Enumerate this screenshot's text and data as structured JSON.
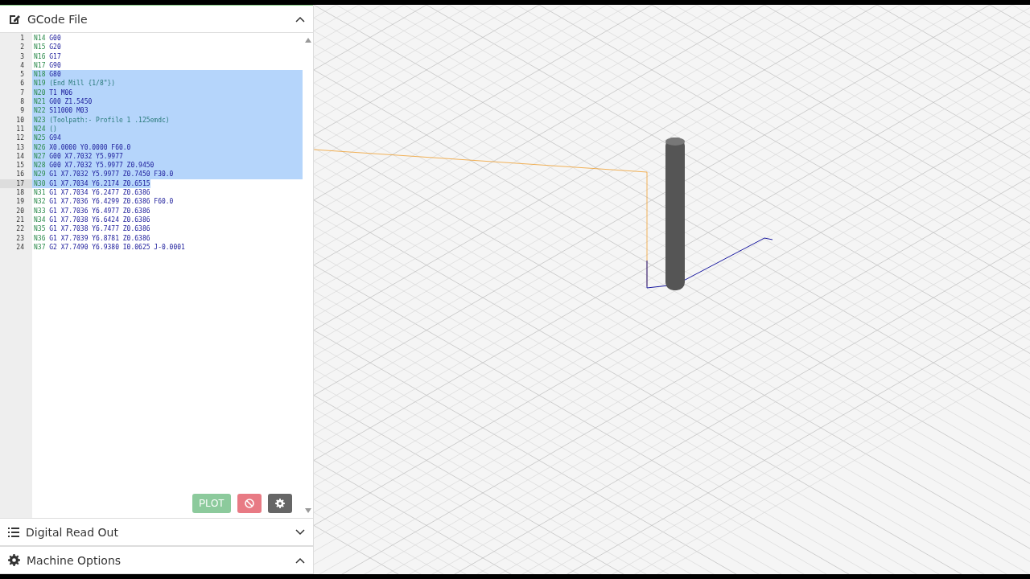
{
  "panels": [
    {
      "title": "GCode File",
      "kind": "edit",
      "expanded": true
    },
    {
      "title": "Digital Read Out",
      "kind": "list",
      "expanded": false
    },
    {
      "title": "Machine Options",
      "kind": "gear",
      "expanded": true
    }
  ],
  "editor": {
    "lines": [
      {
        "num": "1",
        "n": "N14",
        "code": "G00",
        "kind": "code",
        "selected": false,
        "current": false
      },
      {
        "num": "2",
        "n": "N15",
        "code": "G20",
        "kind": "code",
        "selected": false,
        "current": false
      },
      {
        "num": "3",
        "n": "N16",
        "code": "G17",
        "kind": "code",
        "selected": false,
        "current": false
      },
      {
        "num": "4",
        "n": "N17",
        "code": "G90",
        "kind": "code",
        "selected": false,
        "current": false
      },
      {
        "num": "5",
        "n": "N18",
        "code": "G80",
        "kind": "code",
        "selected": true,
        "current": false
      },
      {
        "num": "6",
        "n": "N19",
        "code": "(End Mill {1/8\"})",
        "kind": "comment",
        "selected": true,
        "current": false
      },
      {
        "num": "7",
        "n": "N20",
        "code": "T1 M06",
        "kind": "code",
        "selected": true,
        "current": false
      },
      {
        "num": "8",
        "n": "N21",
        "code": "G00 Z1.5450",
        "kind": "code",
        "selected": true,
        "current": false
      },
      {
        "num": "9",
        "n": "N22",
        "code": "S11000 M03",
        "kind": "code",
        "selected": true,
        "current": false
      },
      {
        "num": "10",
        "n": "N23",
        "code": "(Toolpath:- Profile 1 .125emdc)",
        "kind": "comment",
        "selected": true,
        "current": false
      },
      {
        "num": "11",
        "n": "N24",
        "code": "()",
        "kind": "comment",
        "selected": true,
        "current": false
      },
      {
        "num": "12",
        "n": "N25",
        "code": "G94",
        "kind": "code",
        "selected": true,
        "current": false
      },
      {
        "num": "13",
        "n": "N26",
        "code": "X0.0000 Y0.0000 F60.0",
        "kind": "code",
        "selected": true,
        "current": false
      },
      {
        "num": "14",
        "n": "N27",
        "code": "G00 X7.7032 Y5.9977",
        "kind": "code",
        "selected": true,
        "current": false
      },
      {
        "num": "15",
        "n": "N28",
        "code": "G00 X7.7032 Y5.9977 Z0.9450",
        "kind": "code",
        "selected": true,
        "current": false
      },
      {
        "num": "16",
        "n": "N29",
        "code": "G1 X7.7032 Y5.9977 Z0.7450 F30.0",
        "kind": "code",
        "selected": true,
        "current": false
      },
      {
        "num": "17",
        "n": "N30",
        "code": "G1 X7.7034 Y6.2174 Z0.6515",
        "kind": "code",
        "selected": true,
        "current": true
      },
      {
        "num": "18",
        "n": "N31",
        "code": "G1 X7.7034 Y6.2477 Z0.6386",
        "kind": "code",
        "selected": false,
        "current": false
      },
      {
        "num": "19",
        "n": "N32",
        "code": "G1 X7.7036 Y6.4299 Z0.6386 F60.0",
        "kind": "code",
        "selected": false,
        "current": false
      },
      {
        "num": "20",
        "n": "N33",
        "code": "G1 X7.7036 Y6.4977 Z0.6386",
        "kind": "code",
        "selected": false,
        "current": false
      },
      {
        "num": "21",
        "n": "N34",
        "code": "G1 X7.7038 Y6.6424 Z0.6386",
        "kind": "code",
        "selected": false,
        "current": false
      },
      {
        "num": "22",
        "n": "N35",
        "code": "G1 X7.7038 Y6.7477 Z0.6386",
        "kind": "code",
        "selected": false,
        "current": false
      },
      {
        "num": "23",
        "n": "N36",
        "code": "G1 X7.7039 Y6.8781 Z0.6386",
        "kind": "code",
        "selected": false,
        "current": false
      },
      {
        "num": "24",
        "n": "N37",
        "code": "G2 X7.7490 Y6.9380 I0.0625 J-0.0001",
        "kind": "code",
        "selected": false,
        "current": false
      }
    ]
  },
  "buttons": [
    {
      "kind": "plot",
      "label": "PLOT"
    },
    {
      "kind": "cancel"
    },
    {
      "kind": "settings"
    }
  ]
}
